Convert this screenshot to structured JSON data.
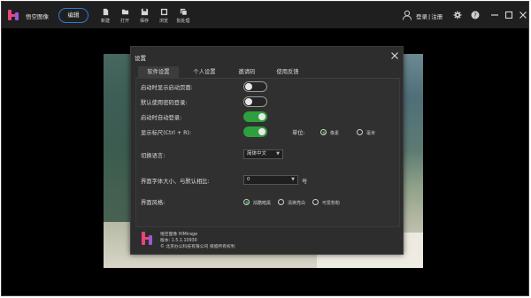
{
  "app": {
    "name": "悟空图像"
  },
  "toolbar": {
    "edit_label": "编辑",
    "tools": [
      {
        "label": "新建",
        "icon": "new-file-icon"
      },
      {
        "label": "打开",
        "icon": "folder-open-icon"
      },
      {
        "label": "保存",
        "icon": "save-icon"
      },
      {
        "label": "浏览",
        "icon": "browse-icon"
      },
      {
        "label": "批处理",
        "icon": "batch-icon"
      }
    ],
    "login_label": "登录",
    "register_label": "注册"
  },
  "dialog": {
    "title": "设置",
    "tabs": [
      {
        "label": "软件设置",
        "active": true
      },
      {
        "label": "个人设置",
        "active": false
      },
      {
        "label": "邀请码",
        "active": false
      },
      {
        "label": "使用反馈",
        "active": false
      }
    ],
    "settings": {
      "show_start_page": {
        "label": "启动时显示启动页面:",
        "on": false
      },
      "default_password_login": {
        "label": "默认使用密码登录:",
        "on": false
      },
      "auto_login": {
        "label": "启动时自动登录:",
        "on": true
      },
      "show_ruler": {
        "label": "显示标尺(Ctrl + R):",
        "on": true
      },
      "unit": {
        "label": "单位:",
        "options": [
          "像素",
          "毫米"
        ],
        "selected": "像素"
      },
      "language": {
        "label": "切换语言:",
        "value": "简体中文"
      },
      "font_size": {
        "label": "界面字体大小、与默认相比:",
        "value": "0",
        "unit": "号"
      },
      "theme": {
        "label": "界面风格:",
        "options": [
          "炫酷暗黑",
          "清爽亮白",
          "可爱粉粉"
        ],
        "selected": "炫酷暗黑"
      }
    },
    "about": {
      "name_line": "悟空图像 HiMirage",
      "version_line": "版本: 1.5.1.10930",
      "copyright_line": "© 北京办公科技有限公司 保留所有权利"
    }
  },
  "colors": {
    "accent_green": "#2e9f3e",
    "accent_blue": "#2f7bd6",
    "logo_pink": "#e8457a",
    "logo_purple": "#9b59d6"
  }
}
